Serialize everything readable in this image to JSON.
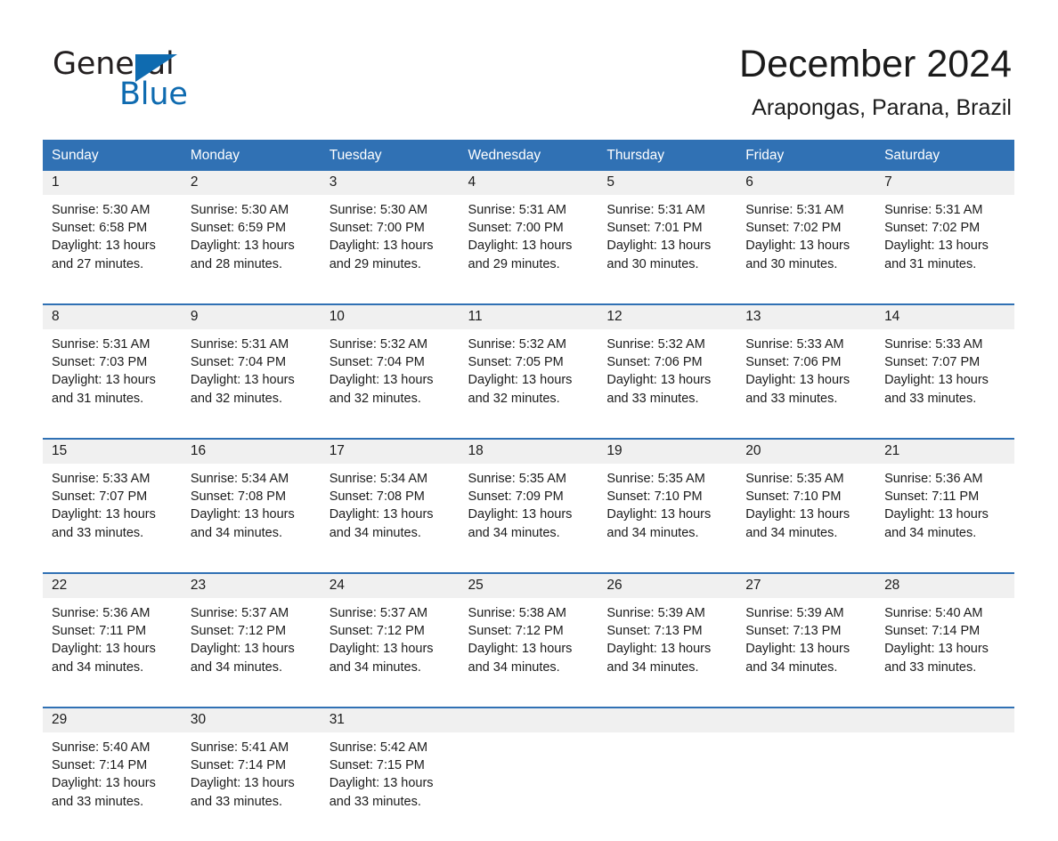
{
  "brand": {
    "name_part1": "General",
    "name_part2": "Blue",
    "accent_color": "#0f6bb0"
  },
  "header": {
    "month_title": "December 2024",
    "location": "Arapongas, Parana, Brazil",
    "header_bg_color": "#3071b4",
    "daynum_bg_color": "#f0f0f0"
  },
  "calendar": {
    "weekday_headers": [
      "Sunday",
      "Monday",
      "Tuesday",
      "Wednesday",
      "Thursday",
      "Friday",
      "Saturday"
    ],
    "weeks": [
      [
        {
          "day": "1",
          "sunrise": "Sunrise: 5:30 AM",
          "sunset": "Sunset: 6:58 PM",
          "daylight_1": "Daylight: 13 hours",
          "daylight_2": "and 27 minutes."
        },
        {
          "day": "2",
          "sunrise": "Sunrise: 5:30 AM",
          "sunset": "Sunset: 6:59 PM",
          "daylight_1": "Daylight: 13 hours",
          "daylight_2": "and 28 minutes."
        },
        {
          "day": "3",
          "sunrise": "Sunrise: 5:30 AM",
          "sunset": "Sunset: 7:00 PM",
          "daylight_1": "Daylight: 13 hours",
          "daylight_2": "and 29 minutes."
        },
        {
          "day": "4",
          "sunrise": "Sunrise: 5:31 AM",
          "sunset": "Sunset: 7:00 PM",
          "daylight_1": "Daylight: 13 hours",
          "daylight_2": "and 29 minutes."
        },
        {
          "day": "5",
          "sunrise": "Sunrise: 5:31 AM",
          "sunset": "Sunset: 7:01 PM",
          "daylight_1": "Daylight: 13 hours",
          "daylight_2": "and 30 minutes."
        },
        {
          "day": "6",
          "sunrise": "Sunrise: 5:31 AM",
          "sunset": "Sunset: 7:02 PM",
          "daylight_1": "Daylight: 13 hours",
          "daylight_2": "and 30 minutes."
        },
        {
          "day": "7",
          "sunrise": "Sunrise: 5:31 AM",
          "sunset": "Sunset: 7:02 PM",
          "daylight_1": "Daylight: 13 hours",
          "daylight_2": "and 31 minutes."
        }
      ],
      [
        {
          "day": "8",
          "sunrise": "Sunrise: 5:31 AM",
          "sunset": "Sunset: 7:03 PM",
          "daylight_1": "Daylight: 13 hours",
          "daylight_2": "and 31 minutes."
        },
        {
          "day": "9",
          "sunrise": "Sunrise: 5:31 AM",
          "sunset": "Sunset: 7:04 PM",
          "daylight_1": "Daylight: 13 hours",
          "daylight_2": "and 32 minutes."
        },
        {
          "day": "10",
          "sunrise": "Sunrise: 5:32 AM",
          "sunset": "Sunset: 7:04 PM",
          "daylight_1": "Daylight: 13 hours",
          "daylight_2": "and 32 minutes."
        },
        {
          "day": "11",
          "sunrise": "Sunrise: 5:32 AM",
          "sunset": "Sunset: 7:05 PM",
          "daylight_1": "Daylight: 13 hours",
          "daylight_2": "and 32 minutes."
        },
        {
          "day": "12",
          "sunrise": "Sunrise: 5:32 AM",
          "sunset": "Sunset: 7:06 PM",
          "daylight_1": "Daylight: 13 hours",
          "daylight_2": "and 33 minutes."
        },
        {
          "day": "13",
          "sunrise": "Sunrise: 5:33 AM",
          "sunset": "Sunset: 7:06 PM",
          "daylight_1": "Daylight: 13 hours",
          "daylight_2": "and 33 minutes."
        },
        {
          "day": "14",
          "sunrise": "Sunrise: 5:33 AM",
          "sunset": "Sunset: 7:07 PM",
          "daylight_1": "Daylight: 13 hours",
          "daylight_2": "and 33 minutes."
        }
      ],
      [
        {
          "day": "15",
          "sunrise": "Sunrise: 5:33 AM",
          "sunset": "Sunset: 7:07 PM",
          "daylight_1": "Daylight: 13 hours",
          "daylight_2": "and 33 minutes."
        },
        {
          "day": "16",
          "sunrise": "Sunrise: 5:34 AM",
          "sunset": "Sunset: 7:08 PM",
          "daylight_1": "Daylight: 13 hours",
          "daylight_2": "and 34 minutes."
        },
        {
          "day": "17",
          "sunrise": "Sunrise: 5:34 AM",
          "sunset": "Sunset: 7:08 PM",
          "daylight_1": "Daylight: 13 hours",
          "daylight_2": "and 34 minutes."
        },
        {
          "day": "18",
          "sunrise": "Sunrise: 5:35 AM",
          "sunset": "Sunset: 7:09 PM",
          "daylight_1": "Daylight: 13 hours",
          "daylight_2": "and 34 minutes."
        },
        {
          "day": "19",
          "sunrise": "Sunrise: 5:35 AM",
          "sunset": "Sunset: 7:10 PM",
          "daylight_1": "Daylight: 13 hours",
          "daylight_2": "and 34 minutes."
        },
        {
          "day": "20",
          "sunrise": "Sunrise: 5:35 AM",
          "sunset": "Sunset: 7:10 PM",
          "daylight_1": "Daylight: 13 hours",
          "daylight_2": "and 34 minutes."
        },
        {
          "day": "21",
          "sunrise": "Sunrise: 5:36 AM",
          "sunset": "Sunset: 7:11 PM",
          "daylight_1": "Daylight: 13 hours",
          "daylight_2": "and 34 minutes."
        }
      ],
      [
        {
          "day": "22",
          "sunrise": "Sunrise: 5:36 AM",
          "sunset": "Sunset: 7:11 PM",
          "daylight_1": "Daylight: 13 hours",
          "daylight_2": "and 34 minutes."
        },
        {
          "day": "23",
          "sunrise": "Sunrise: 5:37 AM",
          "sunset": "Sunset: 7:12 PM",
          "daylight_1": "Daylight: 13 hours",
          "daylight_2": "and 34 minutes."
        },
        {
          "day": "24",
          "sunrise": "Sunrise: 5:37 AM",
          "sunset": "Sunset: 7:12 PM",
          "daylight_1": "Daylight: 13 hours",
          "daylight_2": "and 34 minutes."
        },
        {
          "day": "25",
          "sunrise": "Sunrise: 5:38 AM",
          "sunset": "Sunset: 7:12 PM",
          "daylight_1": "Daylight: 13 hours",
          "daylight_2": "and 34 minutes."
        },
        {
          "day": "26",
          "sunrise": "Sunrise: 5:39 AM",
          "sunset": "Sunset: 7:13 PM",
          "daylight_1": "Daylight: 13 hours",
          "daylight_2": "and 34 minutes."
        },
        {
          "day": "27",
          "sunrise": "Sunrise: 5:39 AM",
          "sunset": "Sunset: 7:13 PM",
          "daylight_1": "Daylight: 13 hours",
          "daylight_2": "and 34 minutes."
        },
        {
          "day": "28",
          "sunrise": "Sunrise: 5:40 AM",
          "sunset": "Sunset: 7:14 PM",
          "daylight_1": "Daylight: 13 hours",
          "daylight_2": "and 33 minutes."
        }
      ],
      [
        {
          "day": "29",
          "sunrise": "Sunrise: 5:40 AM",
          "sunset": "Sunset: 7:14 PM",
          "daylight_1": "Daylight: 13 hours",
          "daylight_2": "and 33 minutes."
        },
        {
          "day": "30",
          "sunrise": "Sunrise: 5:41 AM",
          "sunset": "Sunset: 7:14 PM",
          "daylight_1": "Daylight: 13 hours",
          "daylight_2": "and 33 minutes."
        },
        {
          "day": "31",
          "sunrise": "Sunrise: 5:42 AM",
          "sunset": "Sunset: 7:15 PM",
          "daylight_1": "Daylight: 13 hours",
          "daylight_2": "and 33 minutes."
        },
        {
          "day": "",
          "sunrise": "",
          "sunset": "",
          "daylight_1": "",
          "daylight_2": ""
        },
        {
          "day": "",
          "sunrise": "",
          "sunset": "",
          "daylight_1": "",
          "daylight_2": ""
        },
        {
          "day": "",
          "sunrise": "",
          "sunset": "",
          "daylight_1": "",
          "daylight_2": ""
        },
        {
          "day": "",
          "sunrise": "",
          "sunset": "",
          "daylight_1": "",
          "daylight_2": ""
        }
      ]
    ]
  }
}
